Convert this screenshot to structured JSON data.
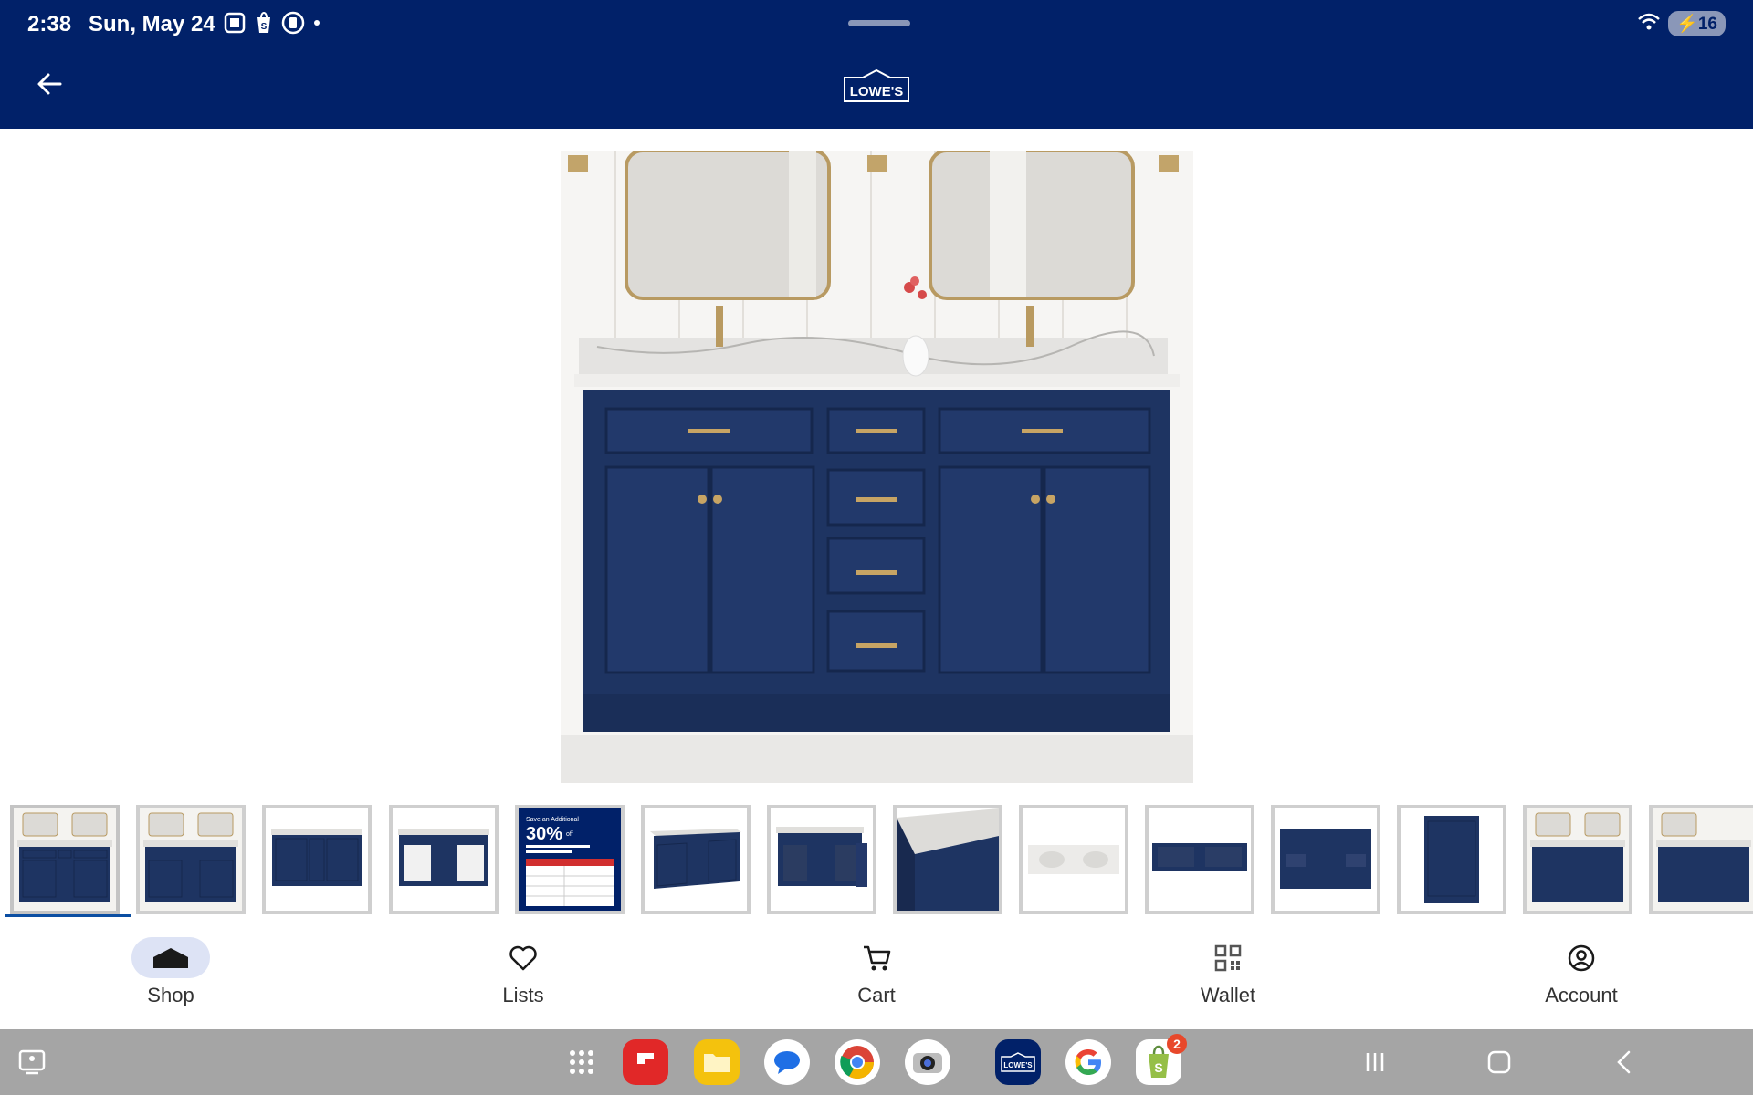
{
  "status_bar": {
    "time": "2:38",
    "date": "Sun, May 24",
    "battery_level": "16"
  },
  "header": {
    "logo_text": "LOWE'S",
    "brand_color": "#012169"
  },
  "product_images": {
    "thumbnail_count": 14,
    "selected_index": 0,
    "promo_thumb": {
      "line1": "Save an Additional",
      "big": "30%",
      "small": "off"
    }
  },
  "bottom_nav": {
    "items": [
      {
        "label": "Shop",
        "icon": "home-icon",
        "active": true
      },
      {
        "label": "Lists",
        "icon": "heart-icon",
        "active": false
      },
      {
        "label": "Cart",
        "icon": "cart-icon",
        "active": false
      },
      {
        "label": "Wallet",
        "icon": "qr-code-icon",
        "active": false
      },
      {
        "label": "Account",
        "icon": "account-icon",
        "active": false
      }
    ]
  },
  "dock": {
    "apps": [
      {
        "name": "app-drawer-icon"
      },
      {
        "name": "flipboard-icon"
      },
      {
        "name": "files-icon"
      },
      {
        "name": "messages-icon"
      },
      {
        "name": "chrome-icon"
      },
      {
        "name": "camera-icon"
      },
      {
        "name": "lowes-app-icon",
        "label": "LOWE'S"
      },
      {
        "name": "google-icon"
      },
      {
        "name": "shopify-icon",
        "badge": "2"
      }
    ]
  },
  "colors": {
    "accent": "#012169",
    "vanity_blue": "#1e3462",
    "indicator": "#0b4ea2"
  }
}
